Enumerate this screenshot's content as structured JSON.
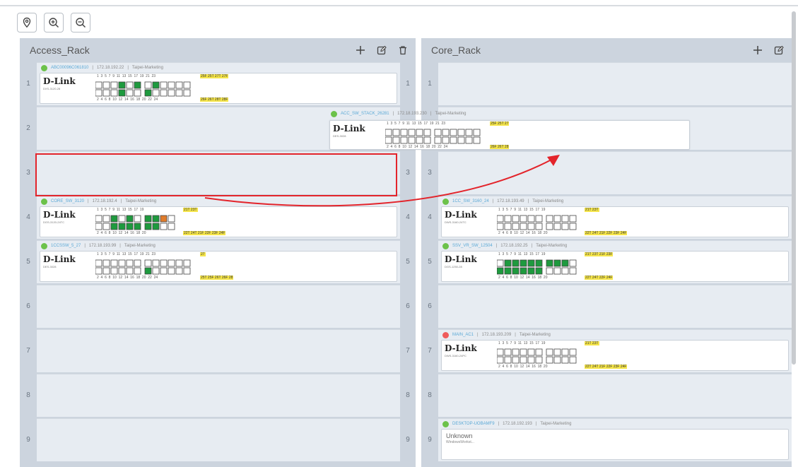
{
  "toolbar": {
    "locate_icon": "location-pin-icon",
    "zoom_in_icon": "zoom-in-icon",
    "zoom_out_icon": "zoom-out-icon"
  },
  "racks": [
    {
      "title": "Access_Rack",
      "actions": [
        "add-icon",
        "edit-icon",
        "delete-icon"
      ],
      "slot_labels": [
        "1",
        "2",
        "3",
        "4",
        "5",
        "6",
        "7",
        "8",
        "9"
      ],
      "devices": [
        {
          "slot": 1,
          "name": "ABC00096C061810",
          "ip": "172.18.192.22",
          "group": "Taipei-Marketing",
          "status": "online",
          "brand": "D-Link",
          "model": "DXS-3120-28",
          "top_labels": "1  3  5  7  9  11  13  15  17  19  21  23",
          "bottom_labels": "2  4  6  8  10  12  14  16  18  20  22  24",
          "uplink_top": "25F 25T 27T 27F",
          "uplink_bottom": "26F 26T 28T 28F"
        },
        {
          "slot": 4,
          "name": "CORE_SW_3120",
          "ip": "172.18.192.4",
          "group": "Taipei-Marketing",
          "status": "online",
          "brand": "D-Link",
          "model": "DGS-3120-24TC",
          "top_labels": "1  3  5  7  9  11  13  15  17  19",
          "bottom_labels": "2  4  6  8  10  12  14  16  18  20",
          "uplink_top": "21T 23T",
          "uplink_bottom": "22T 24T 21F 22F 23F 24F"
        },
        {
          "slot": 5,
          "name": "1CCSSW_5_27",
          "ip": "172.18.193.99",
          "group": "Taipei-Marketing",
          "status": "online",
          "brand": "D-Link",
          "model": "DES-3028",
          "top_labels": "1  3  5  7  9  11  13  15  17  19  21  23",
          "bottom_labels": "2  4  6  8  10  12  14  16  18  20  22  24",
          "uplink_top": "27",
          "uplink_bottom": "25T 25F 26T 26F 28"
        }
      ]
    },
    {
      "title": "Core_Rack",
      "actions": [
        "add-icon",
        "edit-icon"
      ],
      "slot_labels": [
        "1",
        "2",
        "3",
        "4",
        "5",
        "6",
        "7",
        "8",
        "9"
      ],
      "devices": [
        {
          "slot": 4,
          "name": "1CC_SW_3160_24",
          "ip": "172.18.193.49",
          "group": "Taipei-Marketing",
          "status": "online",
          "brand": "D-Link",
          "model": "DWS-3160-24TC",
          "top_labels": "1  3  5  7  9  11  13  15  17  19",
          "bottom_labels": "2  4  6  8  10  12  14  16  18  20",
          "uplink_top": "21T 23T",
          "uplink_bottom": "22T 24T 21F 22F 23F 24F"
        },
        {
          "slot": 5,
          "name": "SSV_VR_SW_12504",
          "ip": "172.18.192.25",
          "group": "Taipei-Marketing",
          "status": "online",
          "brand": "D-Link",
          "model": "DGS-1250-28",
          "top_labels": "1  3  5  7  9  11  13  15  17  19",
          "bottom_labels": "2  4  6  8  10  12  14  16  18  20",
          "uplink_top": "21T 23T 21F 23F",
          "uplink_bottom": "22T 24T 22F 24F"
        },
        {
          "slot": 7,
          "name": "MAIN_AC1",
          "ip": "172.18.193.209",
          "group": "Taipei-Marketing",
          "status": "offline",
          "brand": "D-Link",
          "model": "DWS-3160-24PC",
          "top_labels": "1  3  5  7  9  11  13  15  17  19",
          "bottom_labels": "2  4  6  8  10  12  14  16  18  20",
          "uplink_top": "21T 23T",
          "uplink_bottom": "22T 24T 21F 22F 23F 24F"
        },
        {
          "slot": 9,
          "name": "DESKTOP-UOBAMF9",
          "ip": "172.18.192.193",
          "group": "Taipei-Marketing",
          "status": "online",
          "unknown_label": "Unknown",
          "unknown_sub": "WindowsWorkst..."
        }
      ]
    }
  ],
  "dragging_device": {
    "name": "ACC_SW_STACK_26281",
    "ip": "172.18.193.230",
    "group": "Taipei-Marketing",
    "status": "online",
    "brand": "D-Link",
    "model": "DES-3028",
    "top_labels": "1  3  5  7  9  11  13  15  17  19  21  23",
    "bottom_labels": "2  4  6  8  10  12  14  16  18  20  22  24",
    "uplink_top": "25F 25T 27",
    "uplink_bottom": "26F 26T 28"
  },
  "separator": " | ",
  "colors": {
    "rack_bg": "#ccd4de",
    "slot_bg": "#e7ecf2",
    "port_active": "#1e9a3e",
    "port_warn": "#e07b2a",
    "uplink_label": "#f5e54a",
    "drop_target": "#e3242b",
    "online": "#6cc24a",
    "offline": "#ef5b5b"
  }
}
